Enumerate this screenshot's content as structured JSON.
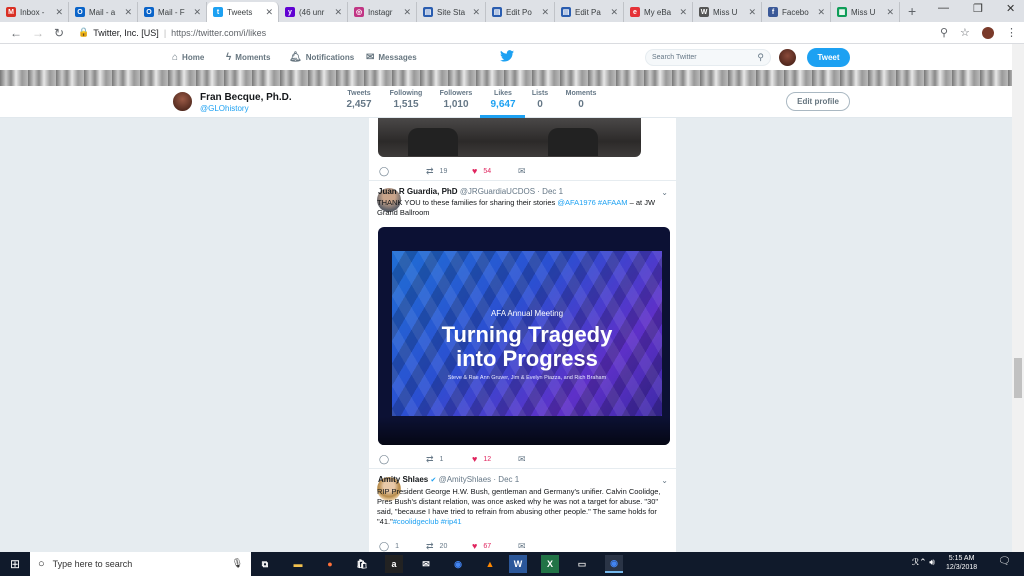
{
  "tabs": [
    {
      "label": "Inbox -",
      "icon": "gmail-icon",
      "color": "#d93025",
      "glyph": "M"
    },
    {
      "label": "Mail - a",
      "icon": "outlook-icon",
      "color": "#0a64c9",
      "glyph": "O"
    },
    {
      "label": "Mail - F",
      "icon": "outlook-icon",
      "color": "#0a64c9",
      "glyph": "O"
    },
    {
      "label": "Tweets",
      "icon": "twitter-icon",
      "color": "#1da1f2",
      "glyph": "t"
    },
    {
      "label": "(46 unr",
      "icon": "yahoo-mail-icon",
      "color": "#6001d2",
      "glyph": "y"
    },
    {
      "label": "Instagr",
      "icon": "instagram-icon",
      "color": "#c13584",
      "glyph": "◎"
    },
    {
      "label": "Site Sta",
      "icon": "site-stats-icon",
      "color": "#2a5db0",
      "glyph": "▤"
    },
    {
      "label": "Edit Po",
      "icon": "edit-post-icon",
      "color": "#2a5db0",
      "glyph": "▤"
    },
    {
      "label": "Edit Pa",
      "icon": "edit-page-icon",
      "color": "#2a5db0",
      "glyph": "▤"
    },
    {
      "label": "My eBa",
      "icon": "ebay-icon",
      "color": "#e53238",
      "glyph": "e"
    },
    {
      "label": "Miss U",
      "icon": "wikipedia-icon",
      "color": "#555555",
      "glyph": "W"
    },
    {
      "label": "Facebo",
      "icon": "facebook-icon",
      "color": "#3b5998",
      "glyph": "f"
    },
    {
      "label": "Miss U",
      "icon": "sheets-icon",
      "color": "#0f9d58",
      "glyph": "▦"
    }
  ],
  "address": {
    "site": "Twitter, Inc. [US]",
    "url": "https://twitter.com/i/likes"
  },
  "nav": {
    "home": "Home",
    "moments": "Moments",
    "notifications": "Notifications",
    "messages": "Messages",
    "search_placeholder": "Search Twitter",
    "tweet_button": "Tweet"
  },
  "profile": {
    "name": "Fran Becque, Ph.D.",
    "handle": "@GLOhistory",
    "edit": "Edit profile",
    "stats": [
      {
        "label": "Tweets",
        "value": "2,457"
      },
      {
        "label": "Following",
        "value": "1,515"
      },
      {
        "label": "Followers",
        "value": "1,010"
      },
      {
        "label": "Likes",
        "value": "9,647"
      },
      {
        "label": "Lists",
        "value": "0"
      },
      {
        "label": "Moments",
        "value": "0"
      }
    ]
  },
  "tweets": [
    {
      "retweets": "19",
      "likes": "54"
    },
    {
      "name": "Juan R Guardia, PhD",
      "handle": "@JRGuardiaUCDOS",
      "date": "· Dec 1",
      "text_pre": "THANK YOU to these families for sharing their stories ",
      "links": "@AFA1976 #AFAAM",
      "text_post": " – at JW Grand Ballroom",
      "slide_small": "AFA Annual Meeting",
      "slide_big1": "Turning Tragedy",
      "slide_big2": "into Progress",
      "slide_names": "Steve & Rae Ann Gruver, Jim & Evelyn Piazza, and Rich Braham",
      "retweets": "1",
      "likes": "12"
    },
    {
      "name": "Amity Shlaes",
      "handle": "@AmityShlaes",
      "date": "· Dec 1",
      "text": "RIP President George H.W. Bush, gentleman and Germany's unifier. Calvin Coolidge, Pres Bush's distant relation, was once asked why he was not a target for abuse. \"30\" said, \"because I have tried to refrain from abusing other people.\" The same holds for \"41.\"",
      "tags": "#coolidgeclub #rip41",
      "replies": "1",
      "retweets": "20",
      "likes": "67"
    }
  ],
  "taskbar": {
    "search": "Type here to search",
    "time": "5:15 AM",
    "date": "12/3/2018"
  }
}
